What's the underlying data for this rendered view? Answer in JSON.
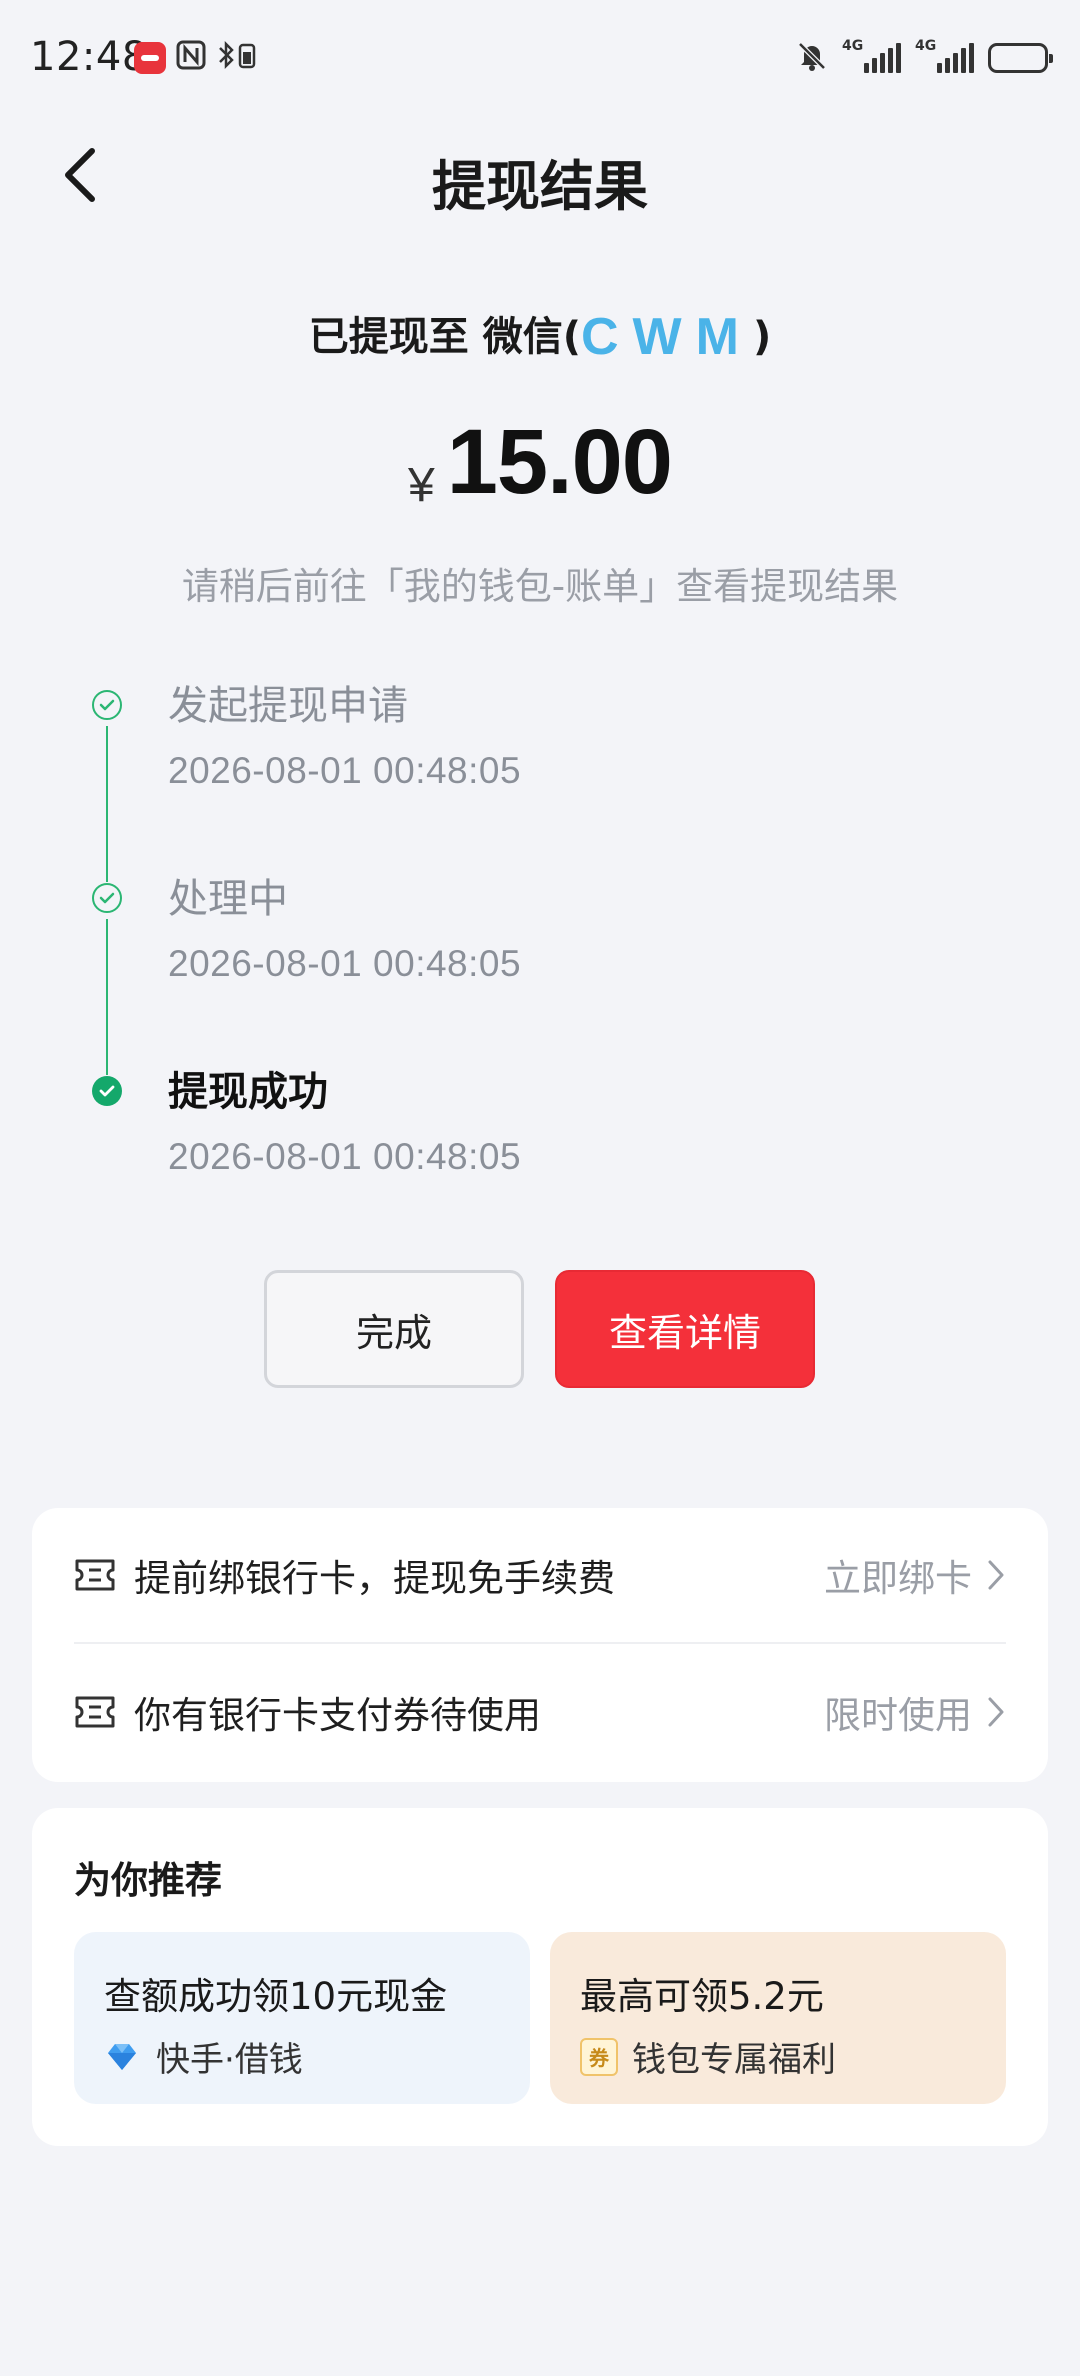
{
  "status_bar": {
    "time": "12:48",
    "signal_1_tag": "4G",
    "signal_2_tag": "4G"
  },
  "header": {
    "title": "提现结果"
  },
  "withdraw": {
    "destination_prefix": "已提现至 微信(",
    "nickname": "CWM",
    "destination_suffix": ")",
    "currency_symbol": "¥",
    "amount": "15.00",
    "hint": "请稍后前往「我的钱包-账单」查看提现结果"
  },
  "timeline": [
    {
      "label": "发起提现申请",
      "time": "2026-08-01 00:48:05"
    },
    {
      "label": "处理中",
      "time": "2026-08-01 00:48:05"
    },
    {
      "label": "提现成功",
      "time": "2026-08-01 00:48:05"
    }
  ],
  "buttons": {
    "done": "完成",
    "detail": "查看详情"
  },
  "promos": [
    {
      "text": "提前绑银行卡，提现免手续费",
      "action": "立即绑卡"
    },
    {
      "text": "你有银行卡支付券待使用",
      "action": "限时使用"
    }
  ],
  "recommend": {
    "title": "为你推荐",
    "tiles": [
      {
        "head": "查额成功领10元现金",
        "sub": "快手·借钱"
      },
      {
        "head": "最高可领5.2元",
        "sub": "钱包专属福利",
        "badge": "券"
      }
    ]
  },
  "colors": {
    "accent_red": "#f4303a",
    "success_green": "#14a86b",
    "nickname_blue": "#4ab3e8"
  }
}
